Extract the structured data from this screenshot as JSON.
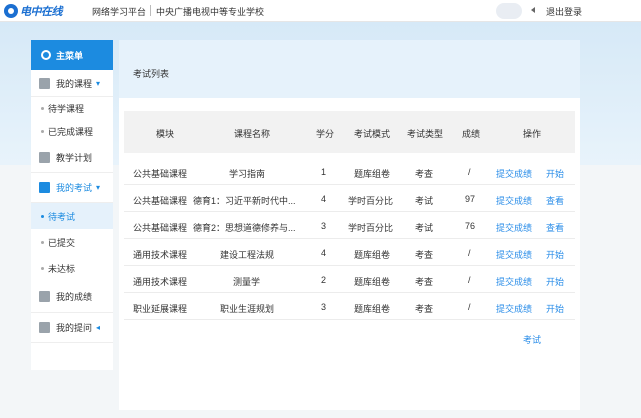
{
  "header": {
    "logo_text": "电中在线",
    "platform": "网络学习平台",
    "school": "中央广播电视中等专业学校",
    "logout": "退出登录"
  },
  "sidebar": {
    "main_menu": "主菜单",
    "my_courses": "我的课程",
    "pending_courses": "待学课程",
    "done_courses": "已完成课程",
    "teaching_plan": "教学计划",
    "my_exams": "我的考试",
    "pending_exam": "待考试",
    "submitted": "已提交",
    "not_passed": "未达标",
    "my_grades": "我的成绩",
    "my_questions": "我的提问"
  },
  "panel": {
    "title": "考试列表",
    "columns": [
      "模块",
      "课程名称",
      "学分",
      "考试模式",
      "考试类型",
      "成绩",
      "操作"
    ],
    "rows": [
      {
        "module": "公共基础课程",
        "course": "学习指南",
        "credit": "1",
        "mode": "题库组卷",
        "type": "考查",
        "score": "/",
        "action1": "提交成绩",
        "action2": "开始"
      },
      {
        "module": "公共基础课程",
        "course": "德育1：习近平新时代中...",
        "credit": "4",
        "mode": "学时百分比",
        "type": "考试",
        "score": "97",
        "action1": "提交成绩",
        "action2": "查看"
      },
      {
        "module": "公共基础课程",
        "course": "德育2：思想道德修养与...",
        "credit": "3",
        "mode": "学时百分比",
        "type": "考试",
        "score": "76",
        "action1": "提交成绩",
        "action2": "查看"
      },
      {
        "module": "通用技术课程",
        "course": "建设工程法规",
        "credit": "4",
        "mode": "题库组卷",
        "type": "考查",
        "score": "/",
        "action1": "提交成绩",
        "action2": "开始"
      },
      {
        "module": "通用技术课程",
        "course": "测量学",
        "credit": "2",
        "mode": "题库组卷",
        "type": "考查",
        "score": "/",
        "action1": "提交成绩",
        "action2": "开始"
      },
      {
        "module": "职业延展课程",
        "course": "职业生涯规划",
        "credit": "3",
        "mode": "题库组卷",
        "type": "考查",
        "score": "/",
        "action1": "提交成绩",
        "action2": "开始"
      }
    ],
    "footer_link": "考试"
  }
}
